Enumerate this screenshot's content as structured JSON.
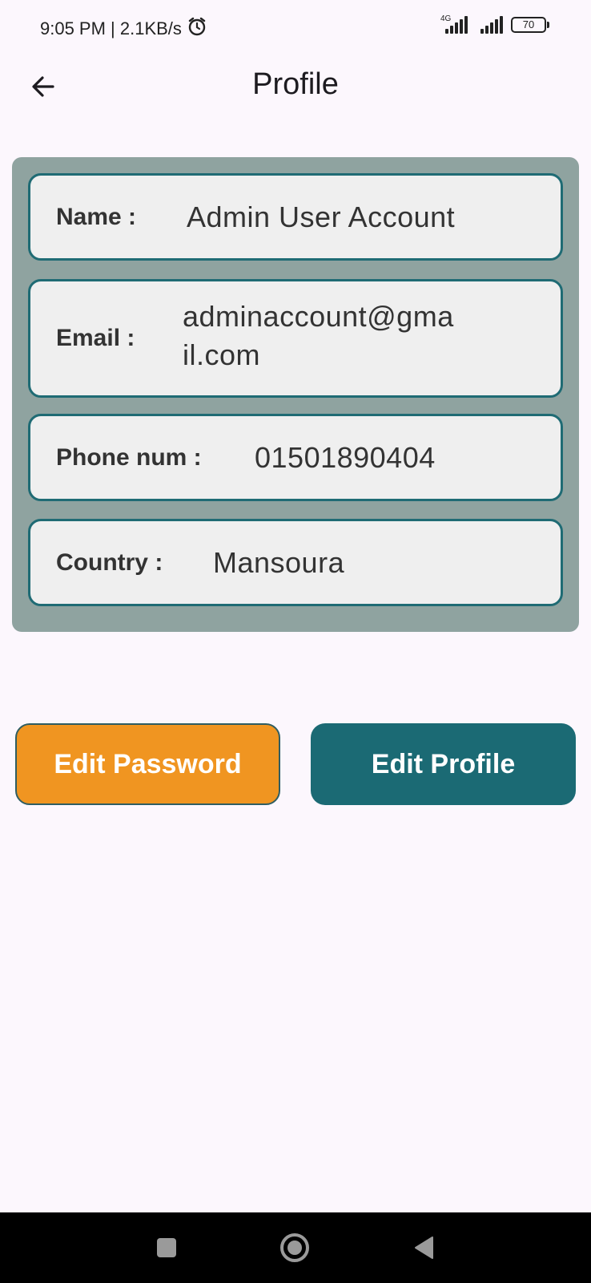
{
  "status_bar": {
    "time_speed": "9:05 PM | 2.1KB/s",
    "network_label": "4G",
    "battery_level": "70"
  },
  "app_bar": {
    "title": "Profile",
    "back_icon": "arrow-left-icon"
  },
  "profile": {
    "fields": [
      {
        "label": "Name  :",
        "value": "Admin User Account"
      },
      {
        "label": "Email  :",
        "value_line1": "adminaccount@gma",
        "value_line2": "il.com"
      },
      {
        "label": "Phone num  :",
        "value": "01501890404"
      },
      {
        "label": "Country  :",
        "value": "Mansoura"
      }
    ]
  },
  "actions": {
    "edit_password_label": "Edit Password",
    "edit_profile_label": "Edit Profile"
  },
  "colors": {
    "background": "#fcf7fd",
    "card": "#8fa3a0",
    "field_border": "#1f6b74",
    "edit_password": "#f09521",
    "edit_profile": "#1b6a74"
  },
  "nav_bar": {
    "icons": [
      "recents-square-icon",
      "home-circle-icon",
      "back-triangle-icon"
    ]
  }
}
